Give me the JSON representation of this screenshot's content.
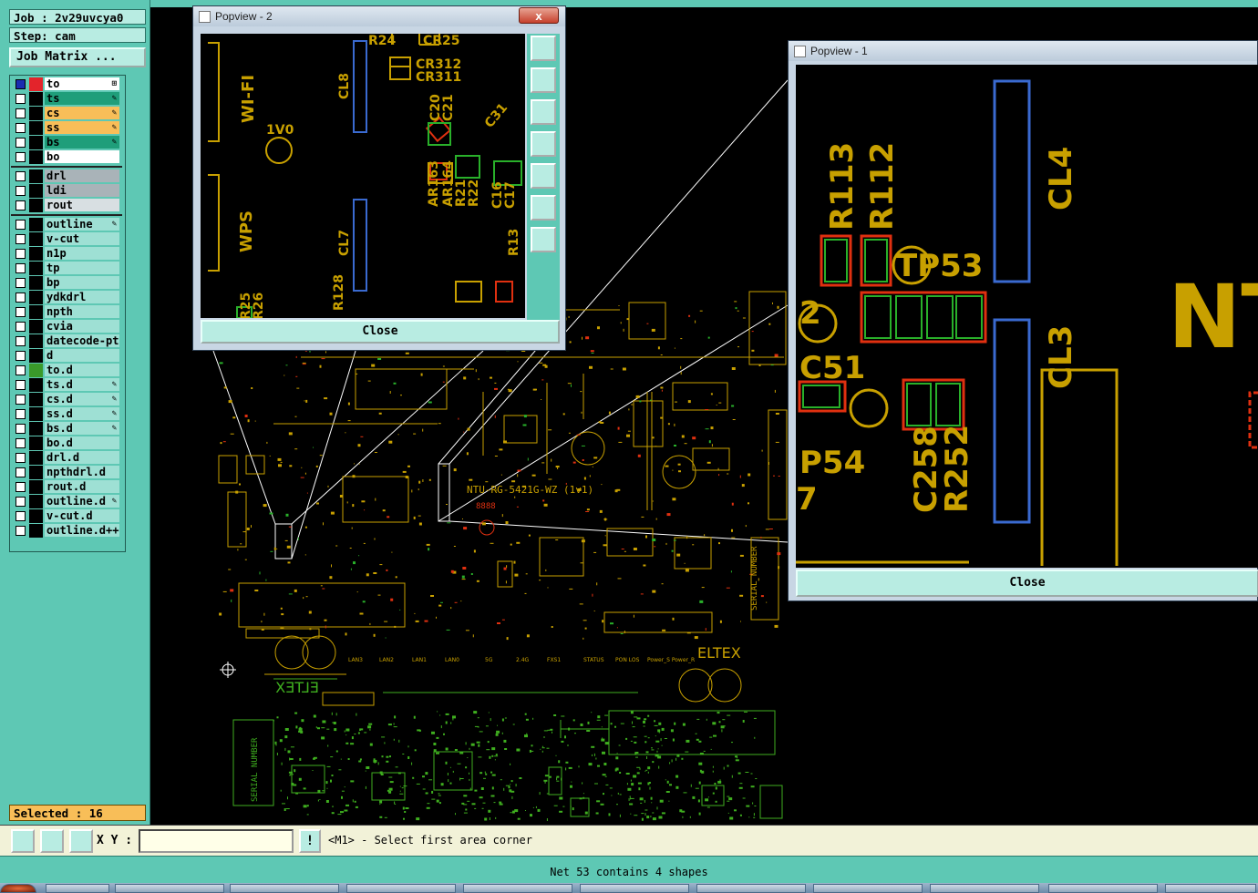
{
  "left_panel": {
    "job": "Job : 2v29uvcya0",
    "step": "Step: cam",
    "job_matrix_button": "Job Matrix ...",
    "selected": "Selected : 16"
  },
  "layers": [
    {
      "name": "to",
      "color": "#ffffff",
      "swatch": "#e3242b",
      "marker": "⊞",
      "group": 1
    },
    {
      "name": "ts",
      "color": "#1f9e7a",
      "swatch": "#000000",
      "marker": "✎",
      "group": 1
    },
    {
      "name": "cs",
      "color": "#f8be58",
      "swatch": "#000000",
      "marker": "✎",
      "group": 1
    },
    {
      "name": "ss",
      "color": "#f8be58",
      "swatch": "#000000",
      "marker": "✎",
      "group": 1
    },
    {
      "name": "bs",
      "color": "#1f9e7a",
      "swatch": "#000000",
      "marker": "✎",
      "group": 1
    },
    {
      "name": "bo",
      "color": "#ffffff",
      "swatch": "#000000",
      "marker": "",
      "group": 1
    },
    {
      "name": "drl",
      "color": "#a9b3b8",
      "swatch": "#000000",
      "marker": "",
      "group": 2
    },
    {
      "name": "ldi",
      "color": "#a9b3b8",
      "swatch": "#000000",
      "marker": "",
      "group": 2
    },
    {
      "name": "rout",
      "color": "#d8dfe2",
      "swatch": "#000000",
      "marker": "",
      "group": 2
    },
    {
      "name": "outline",
      "color": "#9ee0d4",
      "swatch": "#000000",
      "marker": "✎",
      "group": 3
    },
    {
      "name": "v-cut",
      "color": "#9ee0d4",
      "swatch": "#000000",
      "marker": "",
      "group": 3
    },
    {
      "name": "n1p",
      "color": "#9ee0d4",
      "swatch": "#000000",
      "marker": "",
      "group": 3
    },
    {
      "name": "tp",
      "color": "#9ee0d4",
      "swatch": "#000000",
      "marker": "",
      "group": 3
    },
    {
      "name": "bp",
      "color": "#9ee0d4",
      "swatch": "#000000",
      "marker": "",
      "group": 3
    },
    {
      "name": "ydkdrl",
      "color": "#9ee0d4",
      "swatch": "#000000",
      "marker": "",
      "group": 3
    },
    {
      "name": "npth",
      "color": "#9ee0d4",
      "swatch": "#000000",
      "marker": "",
      "group": 3
    },
    {
      "name": "cvia",
      "color": "#9ee0d4",
      "swatch": "#000000",
      "marker": "",
      "group": 3
    },
    {
      "name": "datecode-pte",
      "color": "#9ee0d4",
      "swatch": "#000000",
      "marker": "",
      "group": 3
    },
    {
      "name": "d",
      "color": "#9ee0d4",
      "swatch": "#000000",
      "marker": "",
      "group": 3
    },
    {
      "name": "to.d",
      "color": "#9ee0d4",
      "swatch": "#3a9a2a",
      "marker": "",
      "group": 3
    },
    {
      "name": "ts.d",
      "color": "#9ee0d4",
      "swatch": "#000000",
      "marker": "✎",
      "group": 3
    },
    {
      "name": "cs.d",
      "color": "#9ee0d4",
      "swatch": "#000000",
      "marker": "✎",
      "group": 3
    },
    {
      "name": "ss.d",
      "color": "#9ee0d4",
      "swatch": "#000000",
      "marker": "✎",
      "group": 3
    },
    {
      "name": "bs.d",
      "color": "#9ee0d4",
      "swatch": "#000000",
      "marker": "✎",
      "group": 3
    },
    {
      "name": "bo.d",
      "color": "#9ee0d4",
      "swatch": "#000000",
      "marker": "",
      "group": 3
    },
    {
      "name": "drl.d",
      "color": "#9ee0d4",
      "swatch": "#000000",
      "marker": "",
      "group": 3
    },
    {
      "name": "npthdrl.d",
      "color": "#9ee0d4",
      "swatch": "#000000",
      "marker": "",
      "group": 3
    },
    {
      "name": "rout.d",
      "color": "#9ee0d4",
      "swatch": "#000000",
      "marker": "",
      "group": 3
    },
    {
      "name": "outline.d",
      "color": "#9ee0d4",
      "swatch": "#000000",
      "marker": "✎",
      "group": 3
    },
    {
      "name": "v-cut.d",
      "color": "#9ee0d4",
      "swatch": "#000000",
      "marker": "",
      "group": 3
    },
    {
      "name": "outline.d++",
      "color": "#9ee0d4",
      "swatch": "#000000",
      "marker": "",
      "group": 3
    }
  ],
  "command_bar": {
    "xy_label": "X Y :",
    "xy_value": "",
    "excl_label": "!",
    "prompt": "<M1> - Select first area corner"
  },
  "status": "Net 53 contains 4 shapes",
  "popview2": {
    "title": "Popview - 2",
    "close_x": "x",
    "close_button": "Close",
    "labels": [
      "R24",
      "CR25",
      "CR312",
      "CR311",
      "WI-FI",
      "1V0",
      "CL8",
      "C20",
      "C21",
      "C31",
      "AR163",
      "AR164",
      "R21",
      "R22",
      "C16",
      "C17",
      "WPS",
      "CL7",
      "R128",
      "R25",
      "R26",
      "R13"
    ]
  },
  "popview1": {
    "title": "Popview - 1",
    "close_button": "Close",
    "labels": [
      "R113",
      "R112",
      "TP53",
      "CL4",
      "NT",
      "2",
      "C51",
      "CL3",
      "P54",
      "7",
      "C258",
      "R252"
    ]
  },
  "board": {
    "board_name": "NTU-RG-5421G-WZ (1v1)",
    "red_code": "8888",
    "brand": "ELTEX",
    "serial": "SERIAL NUMBER",
    "leds": [
      "LAN3",
      "LAN2",
      "LAN1",
      "LAN0",
      "5G",
      "2.4G",
      "FXS1",
      "STATUS",
      "PON LOS",
      "Power_S Power_R"
    ]
  },
  "colors": {
    "panel": "#5ec8b4",
    "copper": "#c8a000",
    "green_silk": "#3fae1f",
    "pad_red": "#e03010",
    "pad_green": "#29b02a",
    "blue": "#3a6ad0"
  }
}
